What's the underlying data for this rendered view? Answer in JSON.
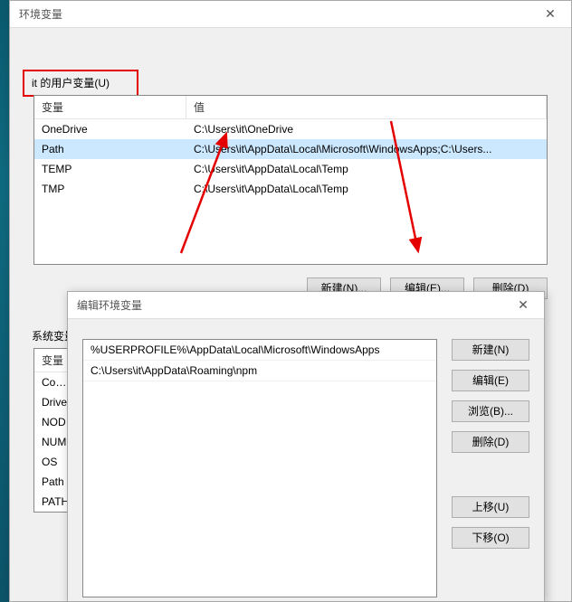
{
  "dlg1": {
    "title": "环境变量",
    "user_group_label": "it 的用户变量(U)",
    "cols": {
      "var": "变量",
      "val": "值"
    },
    "user_vars": [
      {
        "name": "OneDrive",
        "value": "C:\\Users\\it\\OneDrive"
      },
      {
        "name": "Path",
        "value": "C:\\Users\\it\\AppData\\Local\\Microsoft\\WindowsApps;C:\\Users..."
      },
      {
        "name": "TEMP",
        "value": "C:\\Users\\it\\AppData\\Local\\Temp"
      },
      {
        "name": "TMP",
        "value": "C:\\Users\\it\\AppData\\Local\\Temp"
      }
    ],
    "selected_user_row": 1,
    "buttons": {
      "new": "新建(N)...",
      "edit": "编辑(E)...",
      "del": "删除(D)"
    },
    "sys_group_label": "系统变量",
    "sys_vars": [
      {
        "name": "ComS"
      },
      {
        "name": "Drive"
      },
      {
        "name": "NOD"
      },
      {
        "name": "NUM"
      },
      {
        "name": "OS"
      },
      {
        "name": "Path"
      },
      {
        "name": "PATH"
      }
    ]
  },
  "dlg2": {
    "title": "编辑环境变量",
    "entries": [
      "%USERPROFILE%\\AppData\\Local\\Microsoft\\WindowsApps",
      "C:\\Users\\it\\AppData\\Roaming\\npm"
    ],
    "selected_entry": -1,
    "buttons": {
      "new": "新建(N)",
      "edit": "编辑(E)",
      "browse": "浏览(B)...",
      "del": "删除(D)",
      "up": "上移(U)",
      "down": "下移(O)"
    }
  }
}
